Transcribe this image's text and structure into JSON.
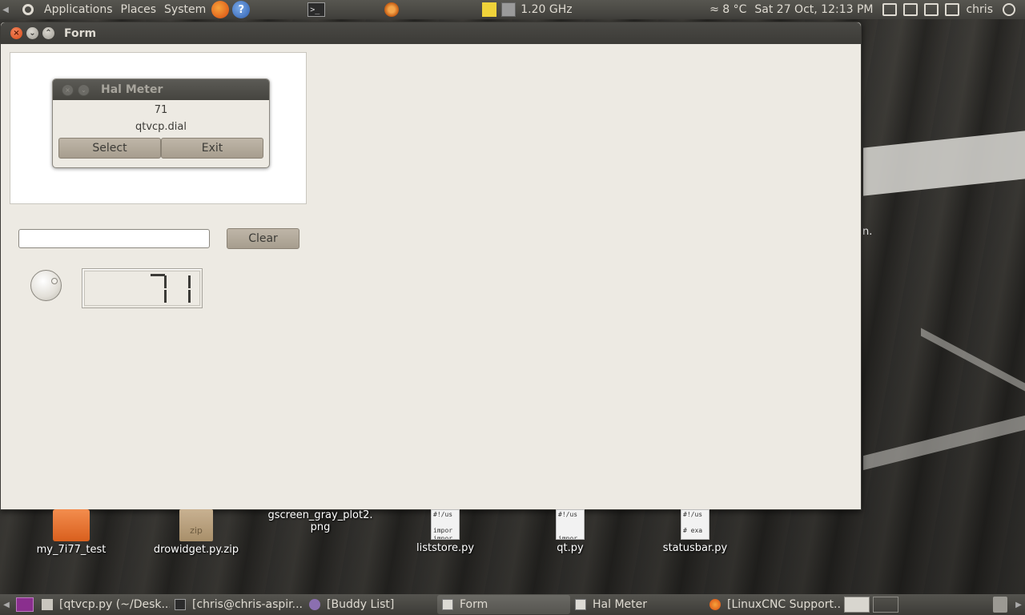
{
  "top_panel": {
    "menus": [
      "Applications",
      "Places",
      "System"
    ],
    "terminal_glyph": ">_",
    "cpu_freq": "1.20 GHz",
    "weather": "≈ 8 °C",
    "clock": "Sat 27 Oct, 12:13 PM",
    "user": "chris"
  },
  "form_window": {
    "title": "Form",
    "hal_meter": {
      "title": "Hal Meter",
      "value": "71",
      "pin": "qtvcp.dial",
      "select_label": "Select",
      "exit_label": "Exit"
    },
    "text_input_value": "",
    "clear_label": "Clear",
    "dial_value": 71,
    "lcd_value": "71"
  },
  "desktop": {
    "stray_text": "n.",
    "icons": [
      {
        "label": "my_7i77_test",
        "type": "folder"
      },
      {
        "label": "drowidget.py.zip",
        "type": "zip",
        "badge": "zip"
      },
      {
        "label": "gscreen_gray_plot2.png",
        "label_line1": "gscreen_gray_plot2.",
        "label_line2": "png",
        "type": "image"
      },
      {
        "label": "liststore.py",
        "type": "script",
        "preview": "#!/us\n\nimpor\nimpor"
      },
      {
        "label": "qt.py",
        "type": "script",
        "preview": "#!/us\n\n\nimpor"
      },
      {
        "label": "statusbar.py",
        "type": "script",
        "preview": "#!/us\n\n# exa"
      }
    ]
  },
  "bottom_panel": {
    "tasks": [
      {
        "label": "[qtvcp.py (~/Desk...",
        "active": false
      },
      {
        "label": "[chris@chris-aspir...",
        "active": false
      },
      {
        "label": "[Buddy List]",
        "active": false
      },
      {
        "label": "Form",
        "active": true
      },
      {
        "label": "Hal Meter",
        "active": false
      },
      {
        "label": "[LinuxCNC Support...",
        "active": false
      }
    ]
  }
}
